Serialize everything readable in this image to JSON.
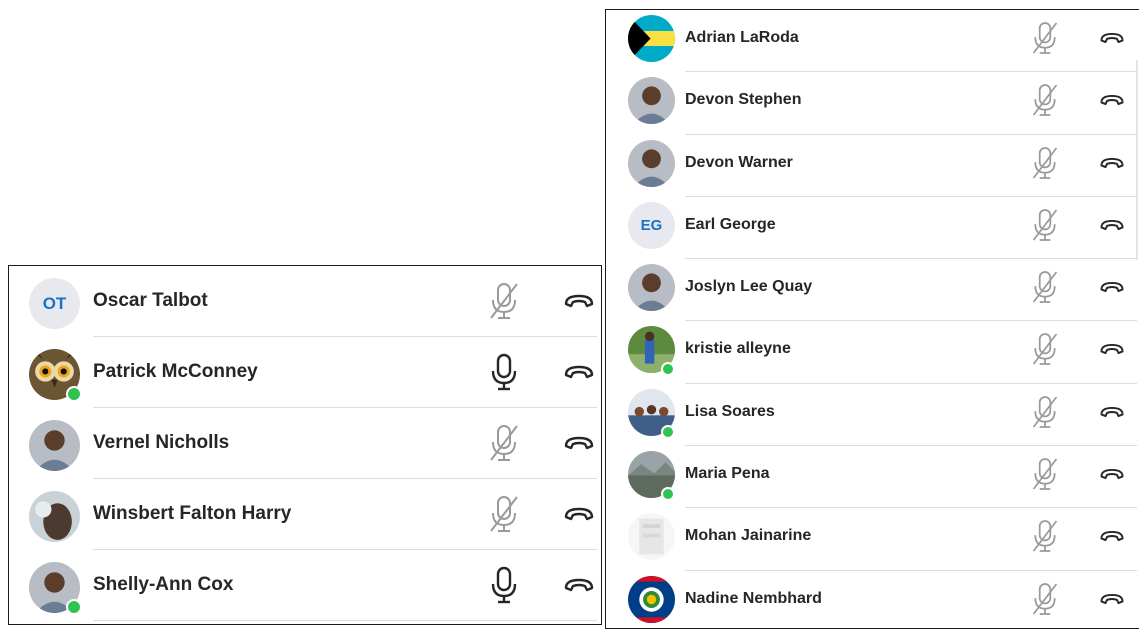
{
  "colors": {
    "initials_text": "#1a73c7",
    "initials_bg": "#e7e9ee",
    "presence_online": "#2fc452",
    "icon_muted": "#9a9a9a",
    "icon_active": "#262626"
  },
  "left_panel": {
    "participants": [
      {
        "name": "Oscar Talbot",
        "initials": "OT",
        "avatar": "initials",
        "online": false,
        "mic": "muted"
      },
      {
        "name": "Patrick McConney",
        "avatar": "owl-photo",
        "online": true,
        "mic": "active"
      },
      {
        "name": "Vernel Nicholls",
        "avatar": "person-photo",
        "online": false,
        "mic": "muted"
      },
      {
        "name": "Winsbert Falton Harry",
        "avatar": "blurry-photo",
        "online": false,
        "mic": "muted"
      },
      {
        "name": "Shelly-Ann Cox",
        "avatar": "person-photo",
        "online": true,
        "mic": "active"
      }
    ]
  },
  "right_panel": {
    "participants": [
      {
        "name": "Adrian LaRoda",
        "avatar": "bahamas-flag",
        "online": false,
        "mic": "muted"
      },
      {
        "name": "Devon Stephen",
        "avatar": "person-photo",
        "online": false,
        "mic": "muted"
      },
      {
        "name": "Devon Warner",
        "avatar": "person-photo",
        "online": false,
        "mic": "muted"
      },
      {
        "name": "Earl George",
        "initials": "EG",
        "avatar": "initials",
        "online": false,
        "mic": "muted"
      },
      {
        "name": "Joslyn Lee Quay",
        "avatar": "person-photo",
        "online": false,
        "mic": "muted"
      },
      {
        "name": "kristie alleyne",
        "avatar": "outdoor-photo",
        "online": true,
        "mic": "muted"
      },
      {
        "name": "Lisa Soares",
        "avatar": "group-photo",
        "online": true,
        "mic": "muted"
      },
      {
        "name": "Maria Pena",
        "avatar": "landscape-photo",
        "online": true,
        "mic": "muted"
      },
      {
        "name": "Mohan Jainarine",
        "avatar": "faded-photo",
        "online": false,
        "mic": "muted"
      },
      {
        "name": "Nadine Nembhard",
        "avatar": "belize-flag",
        "online": false,
        "mic": "muted"
      }
    ]
  }
}
